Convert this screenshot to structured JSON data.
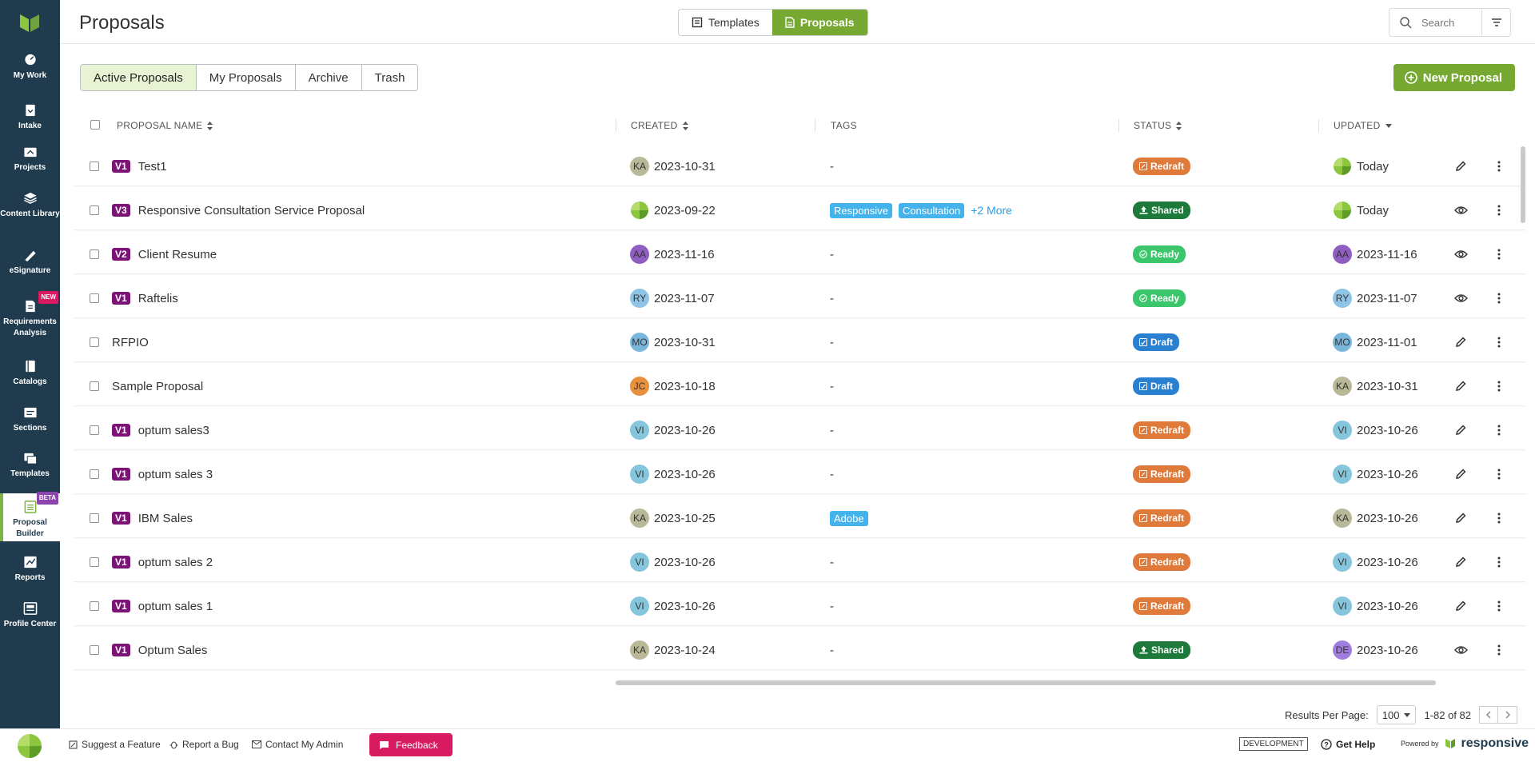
{
  "sidebar": {
    "items": [
      {
        "label": "My Work"
      },
      {
        "label": "Intake"
      },
      {
        "label": "Projects"
      },
      {
        "label": "Content Library"
      },
      {
        "label": "eSignature"
      },
      {
        "label": "Requirements Analysis",
        "badge": "NEW"
      },
      {
        "label": "Catalogs"
      },
      {
        "label": "Sections"
      },
      {
        "label": "Templates"
      },
      {
        "label": "Proposal Builder",
        "badge": "BETA",
        "active": true
      },
      {
        "label": "Reports"
      },
      {
        "label": "Profile Center"
      }
    ]
  },
  "header": {
    "title": "Proposals",
    "toggle": {
      "templates": "Templates",
      "proposals": "Proposals",
      "selected": "Proposals"
    },
    "search_placeholder": "Search"
  },
  "tabs": [
    "Active Proposals",
    "My Proposals",
    "Archive",
    "Trash"
  ],
  "active_tab": "Active Proposals",
  "new_button": "New Proposal",
  "columns": {
    "name": "PROPOSAL NAME",
    "created": "CREATED",
    "tags": "TAGS",
    "status": "STATUS",
    "updated": "UPDATED"
  },
  "rows": [
    {
      "version": "V1",
      "name": "Test1",
      "created_av": "KA",
      "created": "2023-10-31",
      "tags": [],
      "tags_empty": "-",
      "status": "Redraft",
      "updated_av": "logo",
      "updated": "Today",
      "action": "edit"
    },
    {
      "version": "V3",
      "name": "Responsive Consultation Service Proposal",
      "created_av": "logo",
      "created": "2023-09-22",
      "tags": [
        "Responsive",
        "Consultation"
      ],
      "more": "+2 More",
      "status": "Shared",
      "updated_av": "logo",
      "updated": "Today",
      "action": "view"
    },
    {
      "version": "V2",
      "name": "Client Resume",
      "created_av": "AA",
      "created": "2023-11-16",
      "tags": [],
      "tags_empty": "-",
      "status": "Ready",
      "updated_av": "AA",
      "updated": "2023-11-16",
      "action": "view"
    },
    {
      "version": "V1",
      "name": "Raftelis",
      "created_av": "RY",
      "created": "2023-11-07",
      "tags": [],
      "tags_empty": "-",
      "status": "Ready",
      "updated_av": "RY",
      "updated": "2023-11-07",
      "action": "view"
    },
    {
      "version": "",
      "name": "RFPIO",
      "created_av": "MO",
      "created": "2023-10-31",
      "tags": [],
      "tags_empty": "-",
      "status": "Draft",
      "updated_av": "MO",
      "updated": "2023-11-01",
      "action": "edit"
    },
    {
      "version": "",
      "name": "Sample Proposal",
      "created_av": "JC",
      "created": "2023-10-18",
      "tags": [],
      "tags_empty": "-",
      "status": "Draft",
      "updated_av": "KA",
      "updated": "2023-10-31",
      "action": "edit"
    },
    {
      "version": "V1",
      "name": "optum sales3",
      "created_av": "VI",
      "created": "2023-10-26",
      "tags": [],
      "tags_empty": "-",
      "status": "Redraft",
      "updated_av": "VI",
      "updated": "2023-10-26",
      "action": "edit"
    },
    {
      "version": "V1",
      "name": "optum sales 3",
      "created_av": "VI",
      "created": "2023-10-26",
      "tags": [],
      "tags_empty": "-",
      "status": "Redraft",
      "updated_av": "VI",
      "updated": "2023-10-26",
      "action": "edit"
    },
    {
      "version": "V1",
      "name": "IBM Sales",
      "created_av": "KA",
      "created": "2023-10-25",
      "tags": [
        "Adobe"
      ],
      "status": "Redraft",
      "updated_av": "KA",
      "updated": "2023-10-26",
      "action": "edit"
    },
    {
      "version": "V1",
      "name": "optum sales 2",
      "created_av": "VI",
      "created": "2023-10-26",
      "tags": [],
      "tags_empty": "-",
      "status": "Redraft",
      "updated_av": "VI",
      "updated": "2023-10-26",
      "action": "edit"
    },
    {
      "version": "V1",
      "name": "optum sales 1",
      "created_av": "VI",
      "created": "2023-10-26",
      "tags": [],
      "tags_empty": "-",
      "status": "Redraft",
      "updated_av": "VI",
      "updated": "2023-10-26",
      "action": "edit"
    },
    {
      "version": "V1",
      "name": "Optum Sales",
      "created_av": "KA",
      "created": "2023-10-24",
      "tags": [],
      "tags_empty": "-",
      "status": "Shared",
      "updated_av": "DE",
      "updated": "2023-10-26",
      "action": "view"
    }
  ],
  "colors": {
    "Redraft": "#e07a3a",
    "Shared": "#1e7a3a",
    "Ready": "#3cc66b",
    "Draft": "#2a80d0",
    "avatars": {
      "KA": "#b9b99a",
      "AA": "#8e5fc0",
      "RY": "#8fc4e6",
      "MO": "#7ab6dc",
      "JC": "#e8903c",
      "VI": "#86c6dc",
      "DE": "#a07ee0"
    }
  },
  "pager": {
    "label": "Results Per Page:",
    "per_page": "100",
    "range": "1-82 of 82"
  },
  "footer": {
    "suggest": "Suggest a Feature",
    "bug": "Report a Bug",
    "admin": "Contact My Admin",
    "feedback": "Feedback",
    "env": "DEVELOPMENT",
    "help": "Get Help",
    "powered": "Powered by",
    "brand": "responsive"
  }
}
